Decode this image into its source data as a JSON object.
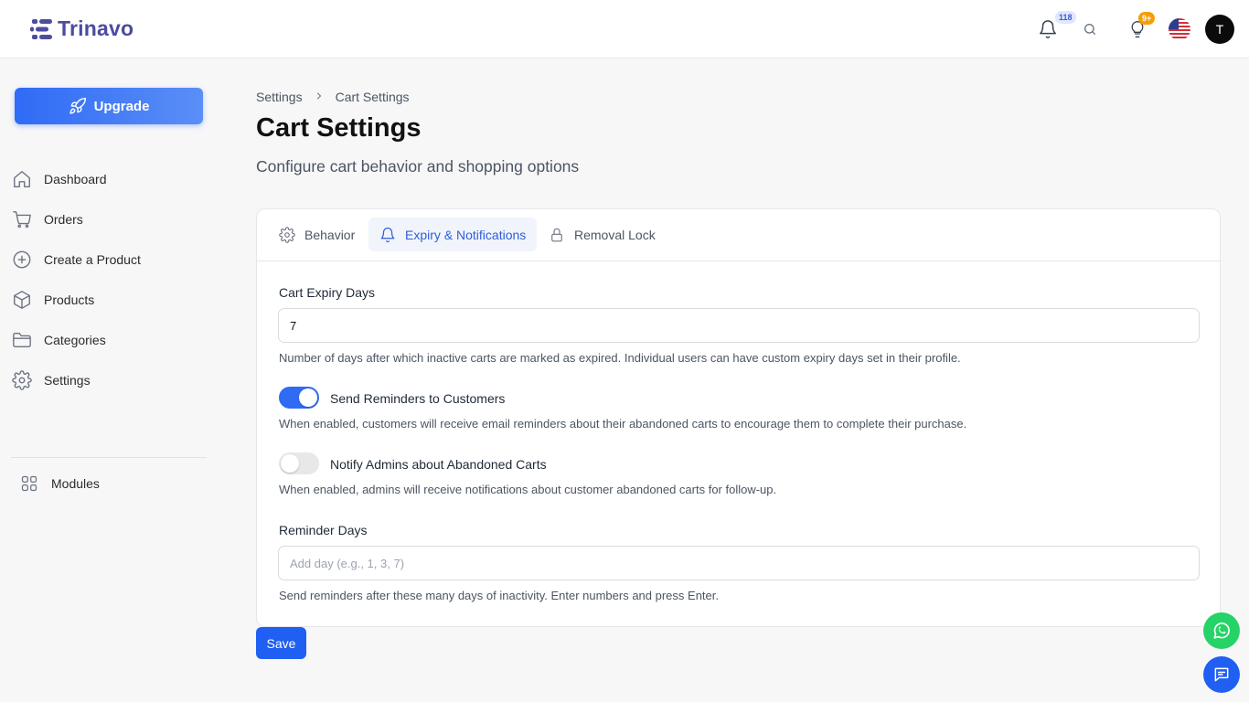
{
  "header": {
    "app_name": "Trinavo",
    "notifications_count": "118",
    "tips_count": "9+",
    "language_flag": "us-flag-icon",
    "avatar_initial": "T"
  },
  "sidebar": {
    "upgrade_label": "Upgrade",
    "items": [
      {
        "label": "Dashboard",
        "icon": "home-icon"
      },
      {
        "label": "Orders",
        "icon": "cart-icon"
      },
      {
        "label": "Create a Product",
        "icon": "plus-circle-icon"
      },
      {
        "label": "Products",
        "icon": "box-icon"
      },
      {
        "label": "Categories",
        "icon": "folder-icon"
      },
      {
        "label": "Settings",
        "icon": "gear-icon"
      }
    ],
    "modules_label": "Modules"
  },
  "breadcrumb": {
    "parent": "Settings",
    "separator": ">",
    "current": "Cart Settings"
  },
  "page": {
    "title": "Cart Settings",
    "subtitle": "Configure cart behavior and shopping options"
  },
  "tabs": [
    {
      "label": "Behavior",
      "icon": "gear-icon",
      "active": false
    },
    {
      "label": "Expiry & Notifications",
      "icon": "bell-icon",
      "active": true
    },
    {
      "label": "Removal Lock",
      "icon": "lock-icon",
      "active": false
    }
  ],
  "form": {
    "expiry_label": "Cart Expiry Days",
    "expiry_value": "7",
    "expiry_help": "Number of days after which inactive carts are marked as expired. Individual users can have custom expiry days set in their profile.",
    "reminders_label": "Send Reminders to Customers",
    "reminders_enabled": true,
    "reminders_help": "When enabled, customers will receive email reminders about their abandoned carts to encourage them to complete their purchase.",
    "notify_admins_label": "Notify Admins about Abandoned Carts",
    "notify_admins_enabled": false,
    "notify_admins_help": "When enabled, admins will receive notifications about customer abandoned carts for follow-up.",
    "reminder_days_label": "Reminder Days",
    "reminder_days_placeholder": "Add day (e.g., 1, 3, 7)",
    "reminder_days_help": "Send reminders after these many days of inactivity. Enter numbers and press Enter."
  },
  "save_label": "Save",
  "colors": {
    "primary": "#1f5ff3",
    "brand": "#4c4ba0",
    "whatsapp": "#25d366",
    "badge_orange": "#f59e0b"
  }
}
